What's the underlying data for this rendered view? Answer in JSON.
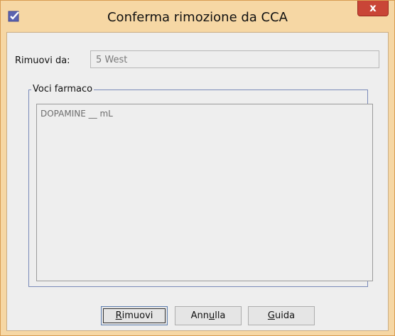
{
  "window": {
    "title": "Conferma rimozione da CCA",
    "close_label": "x",
    "icon": "checkbox-app-icon"
  },
  "form": {
    "rimuovi_da_label": "Rimuovi da:",
    "rimuovi_da_value": "5 West"
  },
  "group": {
    "title": "Voci farmaco",
    "items": [
      "DOPAMINE __ mL"
    ]
  },
  "buttons": {
    "rimuovi_pre": "",
    "rimuovi_ul": "R",
    "rimuovi_post": "imuovi",
    "annulla_pre": "Ann",
    "annulla_ul": "u",
    "annulla_post": "lla",
    "guida_pre": "",
    "guida_ul": "G",
    "guida_post": "uida"
  },
  "colors": {
    "titlebar": "#f6d7a4",
    "close_button": "#c94537",
    "client_bg": "#eeeeee",
    "group_border": "#7a8ab8"
  }
}
